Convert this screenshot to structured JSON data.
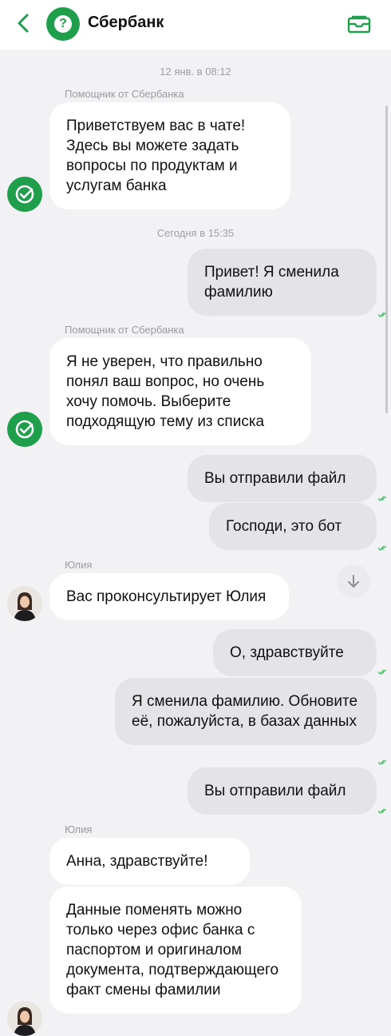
{
  "header": {
    "title": "Сбербанк",
    "logo_glyph": "?",
    "back_icon": "chevron-left-icon",
    "inbox_icon": "inbox-icon",
    "accent_color": "#1f9e4b"
  },
  "messages": {
    "date1": "12 янв. в 08:12",
    "sender1": "Помощник от Сбербанка",
    "m1": "Приветствуем вас в чате! Здесь вы можете задать вопросы по продуктам и услугам банка",
    "date2": "Сегодня в 15:35",
    "m2": "Привет! Я сменила фамилию",
    "sender2": "Помощник от Сбербанка",
    "m3": "Я не уверен, что правильно понял ваш вопрос, но очень хочу помочь. Выберите подходящую тему из списка",
    "m4": "Вы отправили файл",
    "m5": "Господи, это бот",
    "sender3": "Юлия",
    "m6": "Вас проконсультирует Юлия",
    "m7": "О, здравствуйте",
    "m8": "Я сменила фамилию. Обновите её, пожалуйста, в базах данных",
    "m9": "Вы отправили файл",
    "sender4": "Юлия",
    "m10": "Анна, здравствуйте!",
    "m11": "Данные поменять можно только через офис банка с паспортом и оригиналом документа, подтверждающего факт смены фамилии"
  }
}
